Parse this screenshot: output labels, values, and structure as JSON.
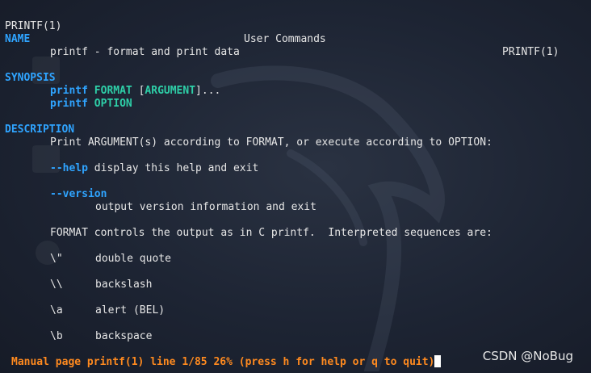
{
  "header": {
    "left": "PRINTF(1)",
    "center": "User Commands",
    "right": "PRINTF(1)"
  },
  "name": {
    "heading": "NAME",
    "text": "printf - format and print data"
  },
  "synopsis": {
    "heading": "SYNOPSIS",
    "line1": {
      "cmd": "printf",
      "format": "FORMAT",
      "bracket_open": "[",
      "argument": "ARGUMENT",
      "rest": "]..."
    },
    "line2": {
      "cmd": "printf",
      "option": "OPTION"
    }
  },
  "description": {
    "heading": "DESCRIPTION",
    "intro": "Print ARGUMENT(s) according to FORMAT, or execute according to OPTION:",
    "help_opt": "--help",
    "help_text": "display this help and exit",
    "version_opt": "--version",
    "version_text": "output version information and exit",
    "format_text": "FORMAT controls the output as in C printf.  Interpreted sequences are:",
    "sequences": [
      {
        "seq": "\\\"",
        "desc": "double quote"
      },
      {
        "seq": "\\\\",
        "desc": "backslash"
      },
      {
        "seq": "\\a",
        "desc": "alert (BEL)"
      },
      {
        "seq": "\\b",
        "desc": "backspace"
      }
    ]
  },
  "status_bar": "Manual page printf(1) line 1/85 26% (press h for help or q to quit)",
  "watermark": "CSDN @NoBug",
  "colors": {
    "section": "#2fa4ff",
    "argument": "#2ecfa8",
    "status": "#ff8a1f",
    "background": "#1d2433"
  }
}
